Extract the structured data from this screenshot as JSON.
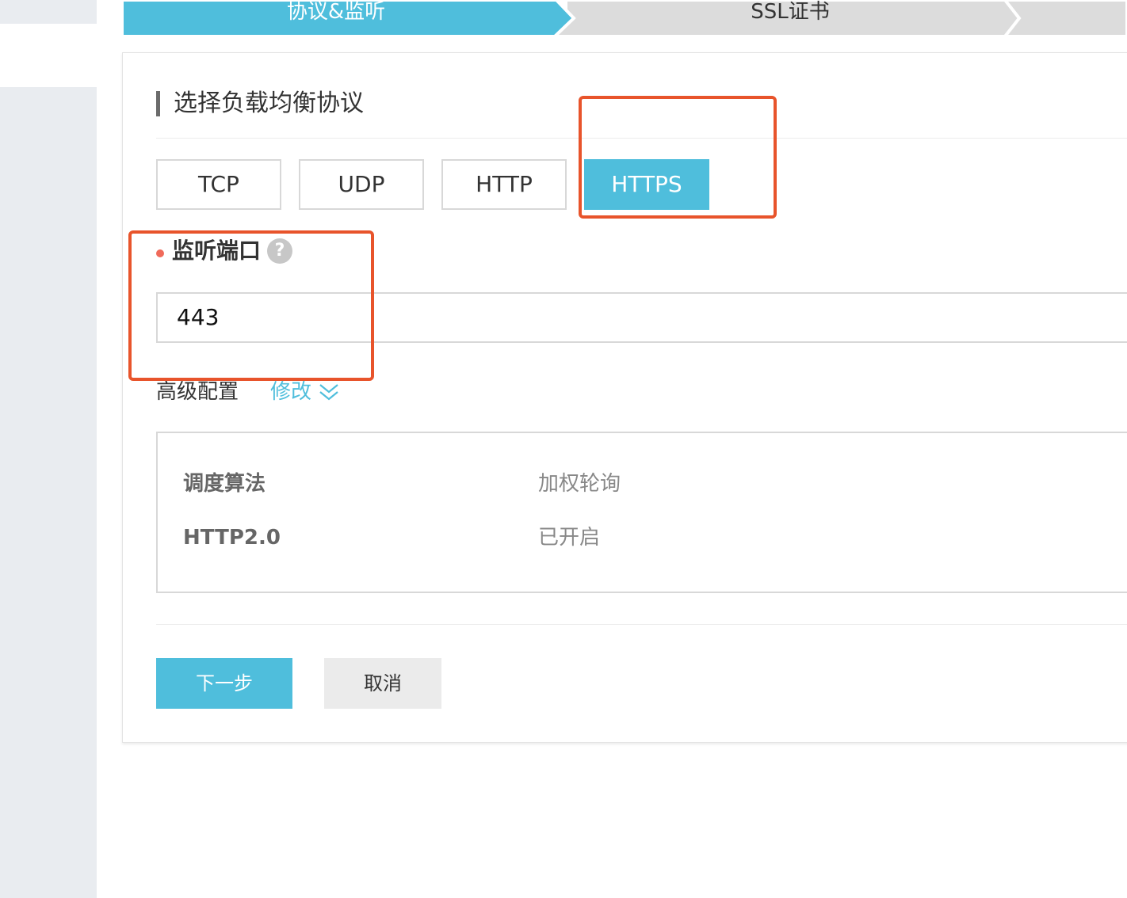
{
  "colors": {
    "accent": "#4fbedc",
    "annotation": "#e8542b",
    "required_dot": "#f06a5a"
  },
  "steps": [
    {
      "label": "协议&监听",
      "state": "active"
    },
    {
      "label": "SSL证书",
      "state": "inactive"
    }
  ],
  "section": {
    "title": "选择负载均衡协议"
  },
  "protocols": [
    {
      "label": "TCP",
      "selected": false
    },
    {
      "label": "UDP",
      "selected": false
    },
    {
      "label": "HTTP",
      "selected": false
    },
    {
      "label": "HTTPS",
      "selected": true
    }
  ],
  "port": {
    "label": "监听端口",
    "required": true,
    "help_icon": "question-mark-icon",
    "help_glyph": "?",
    "value": "443"
  },
  "advanced": {
    "label": "高级配置",
    "edit_label": "修改",
    "edit_icon": "double-chevron-down-icon",
    "rows": [
      {
        "key": "调度算法",
        "value": "加权轮询"
      },
      {
        "key": "HTTP2.0",
        "value": "已开启"
      }
    ]
  },
  "actions": {
    "next_label": "下一步",
    "cancel_label": "取消"
  }
}
